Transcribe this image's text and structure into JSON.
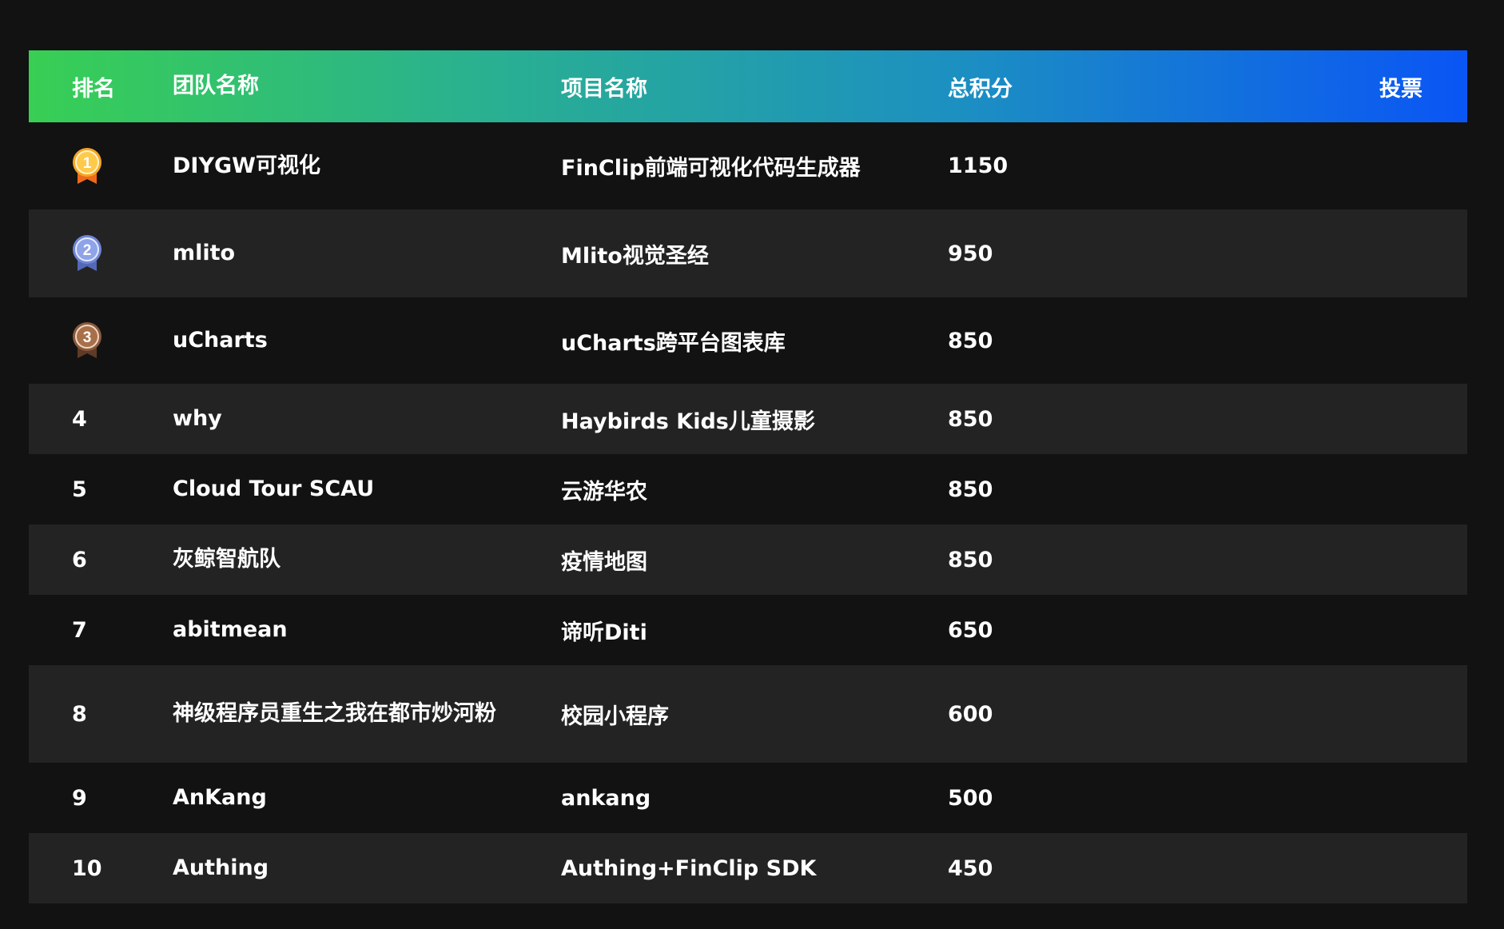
{
  "header": {
    "rank": "排名",
    "team": "团队名称",
    "project": "项目名称",
    "score": "总积分",
    "vote": "投票"
  },
  "colors": {
    "gold": "#f5a623",
    "silver": "#6f86d6",
    "bronze": "#8a5a3c",
    "gradient_start": "#38cf54",
    "gradient_end": "#0a55f5"
  },
  "rows": [
    {
      "rank": "1",
      "medal": "gold-medal-icon",
      "team": "DIYGW可视化",
      "project": "FinClip前端可视化代码生成器",
      "score": "1150"
    },
    {
      "rank": "2",
      "medal": "silver-medal-icon",
      "team": "mlito",
      "project": "Mlito视觉圣经",
      "score": "950"
    },
    {
      "rank": "3",
      "medal": "bronze-medal-icon",
      "team": "uCharts",
      "project": "uCharts跨平台图表库",
      "score": "850"
    },
    {
      "rank": "4",
      "team": "why",
      "project": "Haybirds Kids儿童摄影",
      "score": "850"
    },
    {
      "rank": "5",
      "team": "Cloud Tour SCAU",
      "project": "云游华农",
      "score": "850"
    },
    {
      "rank": "6",
      "team": "灰鲸智航队",
      "project": "疫情地图",
      "score": "850"
    },
    {
      "rank": "7",
      "team": "abitmean",
      "project": "谛听Diti",
      "score": "650"
    },
    {
      "rank": "8",
      "team": "神级程序员重生之我在都市炒河粉",
      "project": "校园小程序",
      "score": "600"
    },
    {
      "rank": "9",
      "team": "AnKang",
      "project": "ankang",
      "score": "500"
    },
    {
      "rank": "10",
      "team": "Authing",
      "project": "Authing+FinClip SDK",
      "score": "450"
    }
  ]
}
